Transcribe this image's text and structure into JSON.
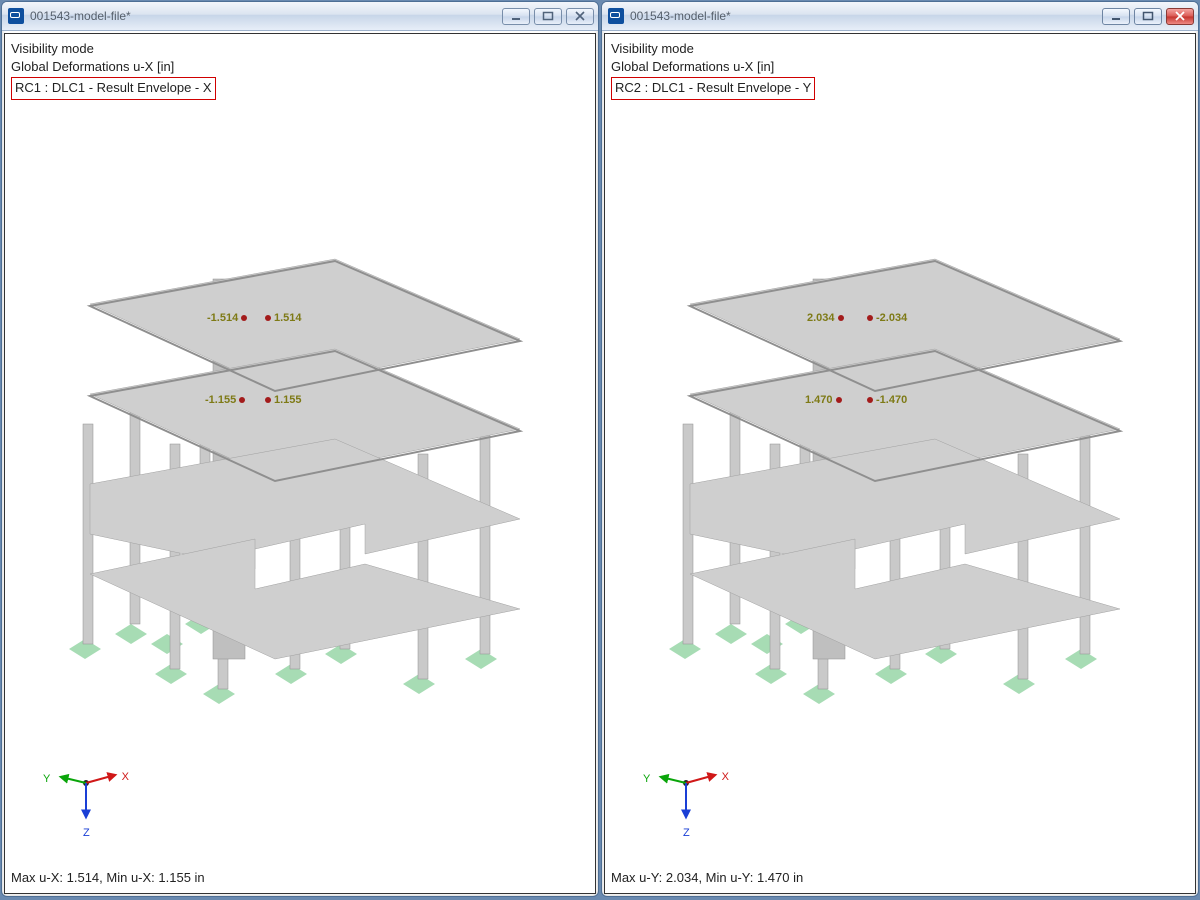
{
  "left": {
    "title": "001543-model-file*",
    "info1": "Visibility mode",
    "info2": "Global Deformations u-X [in]",
    "info3": "RC1 : DLC1 - Result Envelope - X",
    "summary_text": "Max u-X: 1.514, Min u-X: 1.155 in",
    "labels": {
      "top_left_val": "-1.514",
      "top_right_val": "1.514",
      "mid_left_val": "-1.155",
      "mid_right_val": "1.155"
    }
  },
  "right": {
    "title": "001543-model-file*",
    "info1": "Visibility mode",
    "info2": "Global Deformations u-X [in]",
    "info3": "RC2 : DLC1 - Result Envelope - Y",
    "summary_text": "Max u-Y: 2.034, Min u-Y: 1.470 in",
    "labels": {
      "top_left_val": "2.034",
      "top_right_val": "-2.034",
      "mid_left_val": "1.470",
      "mid_right_val": "-1.470"
    }
  },
  "axes": {
    "x": "X",
    "y": "Y",
    "z": "Z"
  }
}
